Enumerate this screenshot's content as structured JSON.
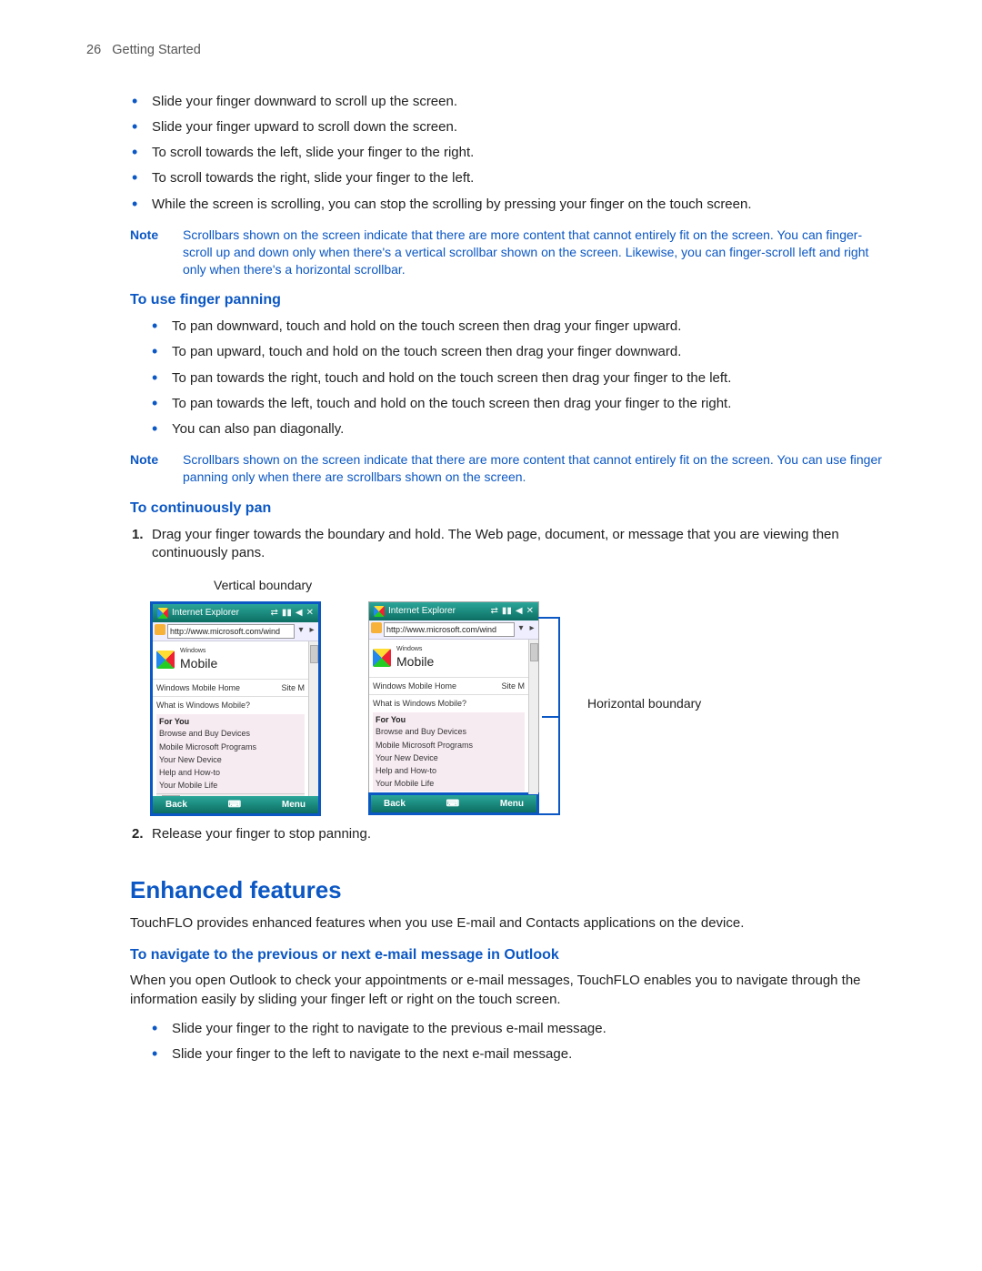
{
  "pageHeader": {
    "pageNum": "26",
    "section": "Getting Started"
  },
  "scrollBullets": [
    "Slide your finger downward to scroll up the screen.",
    "Slide your finger upward to scroll down the screen.",
    "To scroll towards the left, slide your finger to the right.",
    "To scroll towards the right, slide your finger to the left.",
    "While the screen is scrolling, you can stop the scrolling by pressing your finger on the touch screen."
  ],
  "note1Label": "Note",
  "note1Text": "Scrollbars shown on the screen indicate that there are more content that cannot entirely fit on the screen. You can finger-scroll up and down only when there's a vertical scrollbar shown on the screen. Likewise, you can finger-scroll left and right only when there's a horizontal scrollbar.",
  "panHeading": "To use finger panning",
  "panBullets": [
    "To pan downward, touch and hold on the touch screen then drag your finger upward.",
    "To pan upward, touch and hold on the touch screen then drag your finger downward.",
    "To pan towards the right, touch and hold on the touch screen then drag your finger to the left.",
    "To pan towards the left, touch and hold on the touch screen then drag your finger to the right.",
    "You can also pan diagonally."
  ],
  "note2Label": "Note",
  "note2Text": "Scrollbars shown on the screen indicate that there are more content that cannot entirely fit on the screen. You can use finger panning only when there are scrollbars shown on the screen.",
  "contHeading": "To continuously pan",
  "step1Num": "1.",
  "step1Text": "Drag your finger towards the boundary and hold. The Web page, document, or message that you are viewing then continuously pans.",
  "step2Num": "2.",
  "step2Text": "Release your finger to stop panning.",
  "vertCaption": "Vertical boundary",
  "horizCaption": "Horizontal boundary",
  "phone": {
    "title": "Internet Explorer",
    "url": "http://www.microsoft.com/wind",
    "brandSmall": "Windows",
    "brandBig": "Mobile",
    "row2a": "Windows Mobile Home",
    "row2b": "Site M",
    "q": "What is Windows Mobile?",
    "forYou": "For You",
    "items": [
      "Browse and Buy Devices",
      "Mobile Microsoft Programs",
      "Your New Device",
      "Help and How-to",
      "Your Mobile Life"
    ],
    "back": "Back",
    "menu": "Menu"
  },
  "enhHeading": "Enhanced features",
  "enhPara": "TouchFLO provides enhanced features when you use E-mail and Contacts applications on the device.",
  "navHeading": "To navigate to the previous or next e-mail message in Outlook",
  "navPara": "When you open Outlook to check your appointments or e-mail messages, TouchFLO enables you to navigate through the information easily by sliding your finger left or right on the touch screen.",
  "navBullets": [
    "Slide your finger to the right to navigate to the previous e-mail message.",
    "Slide your finger to the left to navigate to the next e-mail message."
  ]
}
